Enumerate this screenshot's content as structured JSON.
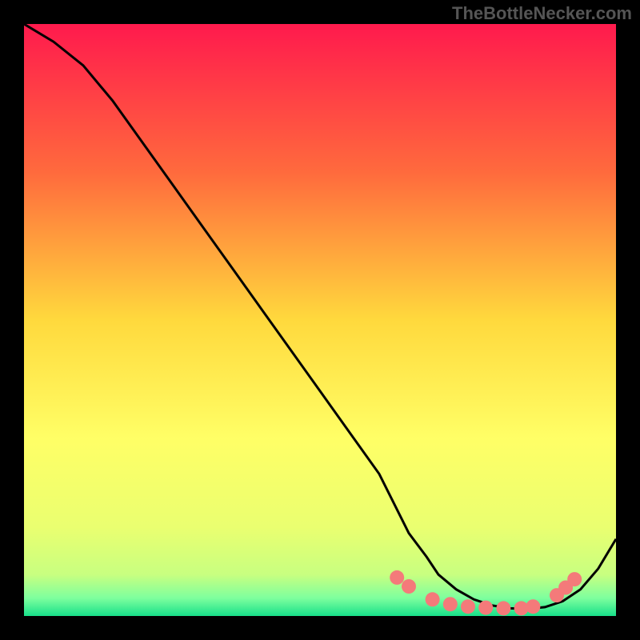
{
  "watermark": "TheBottleNecker.com",
  "chart_data": {
    "type": "line",
    "title": "",
    "xlabel": "",
    "ylabel": "",
    "xlim": [
      0,
      100
    ],
    "ylim": [
      0,
      100
    ],
    "gradient_stops": [
      {
        "offset": 0,
        "color": "#ff1a4d"
      },
      {
        "offset": 25,
        "color": "#ff6a3d"
      },
      {
        "offset": 50,
        "color": "#ffd93d"
      },
      {
        "offset": 70,
        "color": "#ffff66"
      },
      {
        "offset": 85,
        "color": "#eaff70"
      },
      {
        "offset": 93,
        "color": "#c8ff80"
      },
      {
        "offset": 97,
        "color": "#7dff9e"
      },
      {
        "offset": 100,
        "color": "#18e08a"
      }
    ],
    "series": [
      {
        "name": "curve",
        "x": [
          0,
          5,
          10,
          15,
          20,
          25,
          30,
          35,
          40,
          45,
          50,
          55,
          60,
          63,
          65,
          68,
          70,
          73,
          76,
          79,
          82,
          85,
          88,
          91,
          94,
          97,
          100
        ],
        "y": [
          100,
          97,
          93,
          87,
          80,
          73,
          66,
          59,
          52,
          45,
          38,
          31,
          24,
          18,
          14,
          10,
          7,
          4.5,
          2.8,
          1.8,
          1.3,
          1.2,
          1.5,
          2.5,
          4.5,
          8,
          13
        ]
      }
    ],
    "markers": {
      "name": "dots",
      "color": "#f47a7a",
      "points": [
        {
          "x": 63,
          "y": 6.5
        },
        {
          "x": 65,
          "y": 5.0
        },
        {
          "x": 69,
          "y": 2.8
        },
        {
          "x": 72,
          "y": 2.0
        },
        {
          "x": 75,
          "y": 1.6
        },
        {
          "x": 78,
          "y": 1.4
        },
        {
          "x": 81,
          "y": 1.3
        },
        {
          "x": 84,
          "y": 1.3
        },
        {
          "x": 86,
          "y": 1.6
        },
        {
          "x": 90,
          "y": 3.5
        },
        {
          "x": 91.5,
          "y": 4.8
        },
        {
          "x": 93,
          "y": 6.2
        }
      ]
    }
  }
}
